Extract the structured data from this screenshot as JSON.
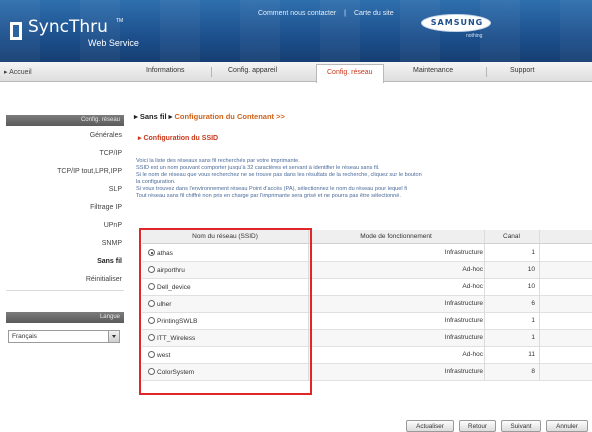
{
  "header": {
    "logo_text": "SyncThru",
    "logo_tm": "TM",
    "logo_sub": "Web Service",
    "links": [
      "Comment nous contacter",
      "|",
      "Carte du site"
    ],
    "brand": "SAMSUNG",
    "brand_tag": "nothing"
  },
  "nav": {
    "home": "▸ Accueil",
    "tabs": [
      "Informations",
      "Config. appareil",
      "Config. réseau",
      "Maintenance",
      "Support"
    ],
    "active_tab": "Config. réseau"
  },
  "sidebar": {
    "section_title": "Config. réseau",
    "items": [
      "Générales",
      "TCP/IP",
      "TCP/IP tout,LPR,IPP",
      "SLP",
      "Filtrage IP",
      "UPnP",
      "SNMP",
      "Sans fil",
      "Réinitialiser"
    ],
    "active_item": "Sans fil",
    "language_title": "Langue",
    "language_value": "Français"
  },
  "main": {
    "crumb_prefix": "▸ Sans fil ▸",
    "crumb_orange": "Configuration du Contenant >>",
    "section_title": "▸ Configuration du SSID",
    "description": [
      "Voici la liste des réseaux sans fil recherchés par votre imprimante.",
      "SSID est un nom pouvant comporter jusqu'à 32 caractères et servant à identifier le réseau sans fil.",
      "Si le nom de réseau que vous recherchez ne se trouve pas dans les résultats de la recherche, cliquez sur le bouton",
      "la configuration.",
      "Si vous trouvez dans l'environnement réseau Point d'accès (PA), sélectionnez le nom du réseau pour lequel fi",
      "Tout réseau sans fil chiffré non pris en charge par l'imprimante sera grisé et ne pourra pas être sélectionné."
    ]
  },
  "table": {
    "headers": [
      "Nom du réseau (SSID)",
      "Mode de fonctionnement",
      "Canal"
    ],
    "rows": [
      {
        "ssid": "athas",
        "mode": "Infrastructure",
        "channel": "1",
        "selected": true
      },
      {
        "ssid": "airporthru",
        "mode": "Ad-hoc",
        "channel": "10",
        "selected": false
      },
      {
        "ssid": "Dell_device",
        "mode": "Ad-hoc",
        "channel": "10",
        "selected": false
      },
      {
        "ssid": "ulher",
        "mode": "Infrastructure",
        "channel": "6",
        "selected": false
      },
      {
        "ssid": "PrintingSWLB",
        "mode": "Infrastructure",
        "channel": "1",
        "selected": false
      },
      {
        "ssid": "ITT_Wireless",
        "mode": "Infrastructure",
        "channel": "1",
        "selected": false
      },
      {
        "ssid": "west",
        "mode": "Ad-hoc",
        "channel": "11",
        "selected": false
      },
      {
        "ssid": "ColorSystem",
        "mode": "Infrastructure",
        "channel": "8",
        "selected": false
      }
    ]
  },
  "buttons": {
    "refresh": "Actualiser",
    "back": "Retour",
    "next": "Suivant",
    "cancel": "Annuler"
  },
  "colors": {
    "header_blue": "#1c4f8c",
    "highlight_red": "#e02626",
    "title_red": "#c8381b",
    "crumb_orange": "#d0621a"
  }
}
